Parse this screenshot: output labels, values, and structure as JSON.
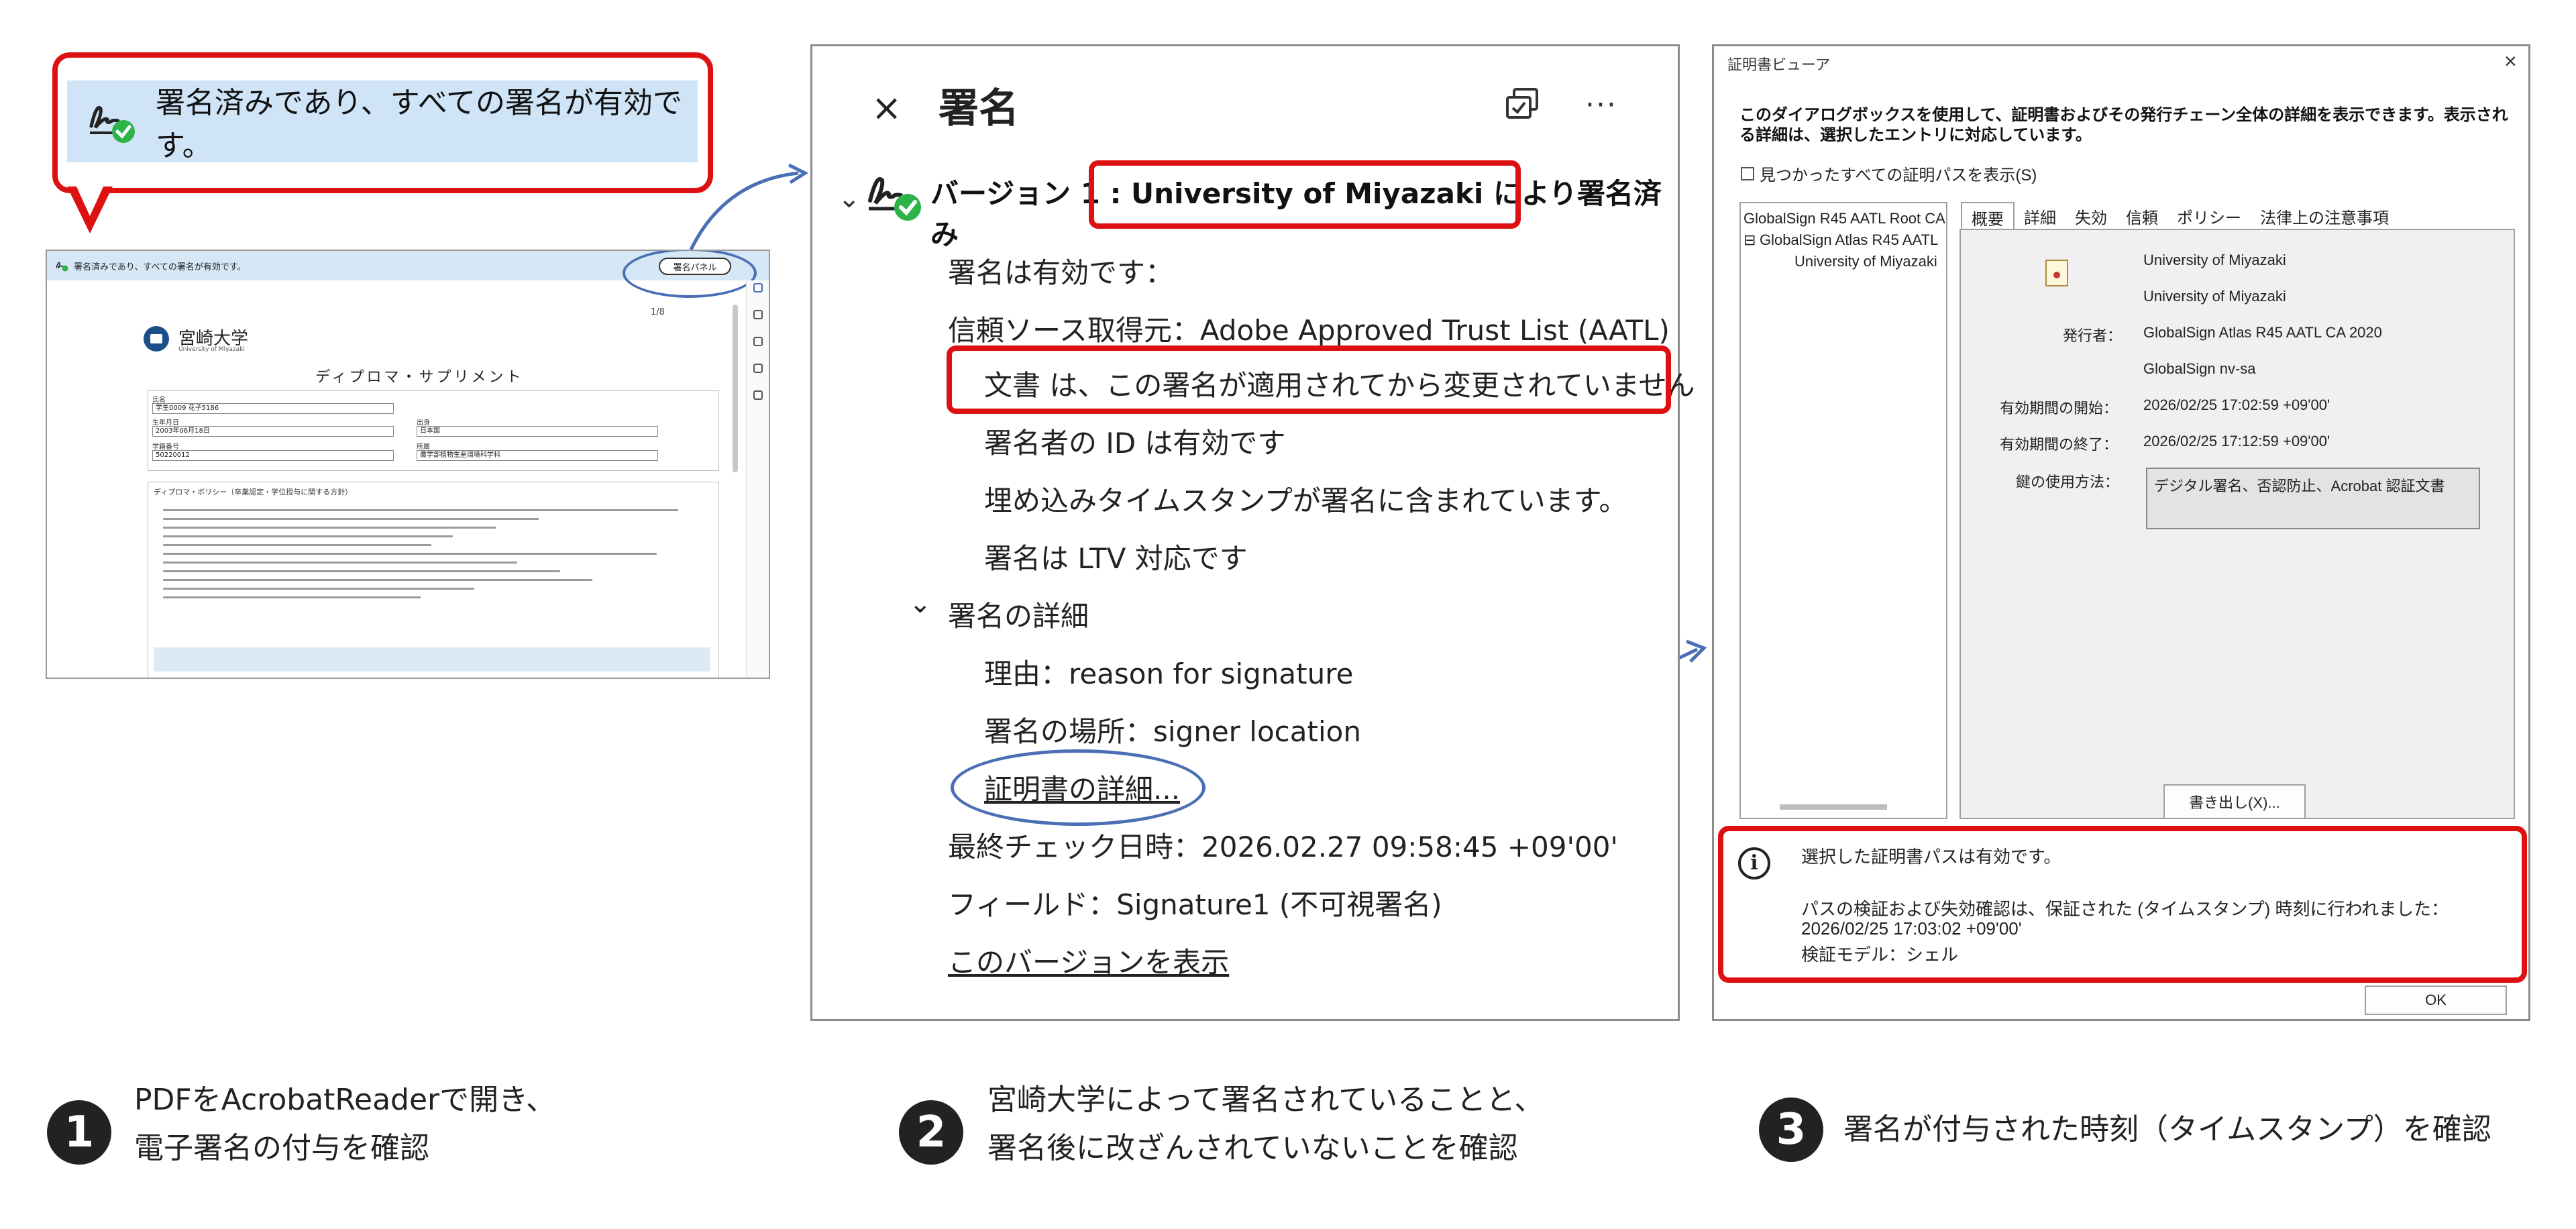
{
  "callout": {
    "text": "署名済みであり、すべての署名が有効です。"
  },
  "doc_preview": {
    "bar_text": "署名済みであり、すべての署名が有効です。",
    "sig_panel_button": "署名パネル",
    "page_number": "1/8",
    "university_name": "宮崎大学",
    "university_en": "University of Miyazaki",
    "doc_title": "ディプロマ・サプリメント",
    "form": {
      "name_label": "氏名",
      "name_value": "学生0009 花子5186",
      "birth_label": "生年月日",
      "birth_value": "2003年06月18日",
      "student_id_label": "学籍番号",
      "student_id_value": "50220012",
      "origin_label": "出身",
      "origin_value": "日本国",
      "faculty_label": "所属",
      "faculty_value": "農学部植物生産環境科学科"
    },
    "policy_title": "ディプロマ・ポリシー（卒業認定・学位授与に関する方針）"
  },
  "signature_panel": {
    "close": "×",
    "title": "署名",
    "more": "···",
    "version": "バージョン 1 : University of Miyazaki により署名済み",
    "rows": {
      "valid": "署名は有効です：",
      "trust_source": "信頼ソース取得元：Adobe Approved Trust List (AATL)",
      "not_modified": "文書 は、この署名が適用されてから変更されていません",
      "signer_id": "署名者の ID は有効です",
      "timestamp": "埋め込みタイムスタンプが署名に含まれています。",
      "ltv": "署名は LTV 対応です",
      "details_header": "署名の詳細",
      "reason": "理由：reason for signature",
      "location": "署名の場所：signer location",
      "cert_details": "証明書の詳細...",
      "last_checked": "最終チェック日時：2026.02.27 09:58:45 +09'00'",
      "field": "フィールド：Signature1 (不可視署名)",
      "view_version": "このバージョンを表示"
    }
  },
  "cert_viewer": {
    "window_title": "証明書ビューア",
    "close": "×",
    "description": "このダイアログボックスを使用して、証明書およびその発行チェーン全体の詳細を表示できます。表示される詳細は、選択したエントリに対応しています。",
    "show_all_paths": "見つかったすべての証明パスを表示(S)",
    "tree": [
      "GlobalSign R45 AATL Root CA",
      "GlobalSign Atlas R45 AATL",
      "University of Miyazaki"
    ],
    "tabs": [
      "概要",
      "詳細",
      "失効",
      "信頼",
      "ポリシー",
      "法律上の注意事項"
    ],
    "summary": {
      "subject": "University of Miyazaki",
      "org": "University of Miyazaki",
      "issuer_label": "発行者：",
      "issuer": "GlobalSign Atlas R45 AATL CA 2020",
      "issuer_org": "GlobalSign nv-sa",
      "valid_from_label": "有効期間の開始：",
      "valid_from": "2026/02/25 17:02:59 +09'00'",
      "valid_to_label": "有効期間の終了：",
      "valid_to": "2026/02/25 17:12:59 +09'00'",
      "key_usage_label": "鍵の使用方法：",
      "key_usage": "デジタル署名、否認防止、Acrobat 認証文書"
    },
    "export_button": "書き出し(X)...",
    "status": {
      "line1": "選択した証明書パスは有効です。",
      "line2": "パスの検証および失効確認は、保証された (タイムスタンプ) 時刻に行われました：",
      "line3": "2026/02/25 17:03:02 +09'00'",
      "line4": "検証モデル：シェル"
    },
    "ok_button": "OK"
  },
  "captions": [
    {
      "num": "1",
      "line1": "PDFをAcrobatReaderで開き、",
      "line2": "電子署名の付与を確認"
    },
    {
      "num": "2",
      "line1": "宮崎大学によって署名されていることと、",
      "line2": "署名後に改ざんされていないことを確認"
    },
    {
      "num": "3",
      "line1": "署名が付与された時刻（タイムスタンプ）を確認",
      "line2": ""
    }
  ],
  "colors": {
    "highlight_red": "#dd1111",
    "annotation_blue": "#4a6fb5",
    "valid_green": "#2db34a",
    "info_bar": "#cfe4f6"
  }
}
